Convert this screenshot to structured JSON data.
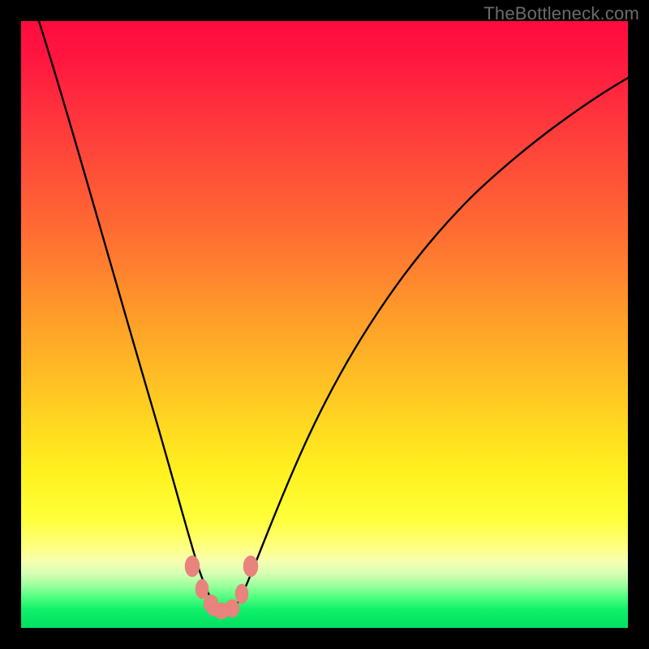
{
  "watermark": "TheBottleneck.com",
  "chart_data": {
    "type": "line",
    "title": "",
    "xlabel": "",
    "ylabel": "",
    "xlim": [
      0,
      100
    ],
    "ylim": [
      0,
      100
    ],
    "grid": false,
    "legend": false,
    "background_gradient": {
      "stops": [
        {
          "pos": 0,
          "color": "#ff0b3e"
        },
        {
          "pos": 0.34,
          "color": "#ff6a33"
        },
        {
          "pos": 0.62,
          "color": "#ffc923"
        },
        {
          "pos": 0.82,
          "color": "#ffff3a"
        },
        {
          "pos": 0.91,
          "color": "#d6ffb4"
        },
        {
          "pos": 1.0,
          "color": "#00e060"
        }
      ]
    },
    "series": [
      {
        "name": "bottleneck-curve",
        "color": "#000000",
        "x": [
          3,
          6,
          10,
          14,
          18,
          22,
          25,
          27,
          29,
          30.5,
          32,
          34,
          36,
          40,
          46,
          54,
          62,
          72,
          84,
          100
        ],
        "y": [
          100,
          86,
          70,
          55,
          41,
          27,
          16,
          9,
          4,
          2,
          2.5,
          5,
          10,
          21,
          36,
          50,
          60,
          68,
          74,
          79
        ]
      }
    ],
    "markers": {
      "name": "highlight-nodes",
      "color": "#e9837d",
      "points": [
        {
          "x": 26.0,
          "y": 10.0
        },
        {
          "x": 27.5,
          "y": 6.5
        },
        {
          "x": 29.0,
          "y": 4.0
        },
        {
          "x": 30.5,
          "y": 2.6
        },
        {
          "x": 32.0,
          "y": 2.6
        },
        {
          "x": 33.5,
          "y": 4.5
        },
        {
          "x": 35.5,
          "y": 10.0
        }
      ]
    }
  }
}
